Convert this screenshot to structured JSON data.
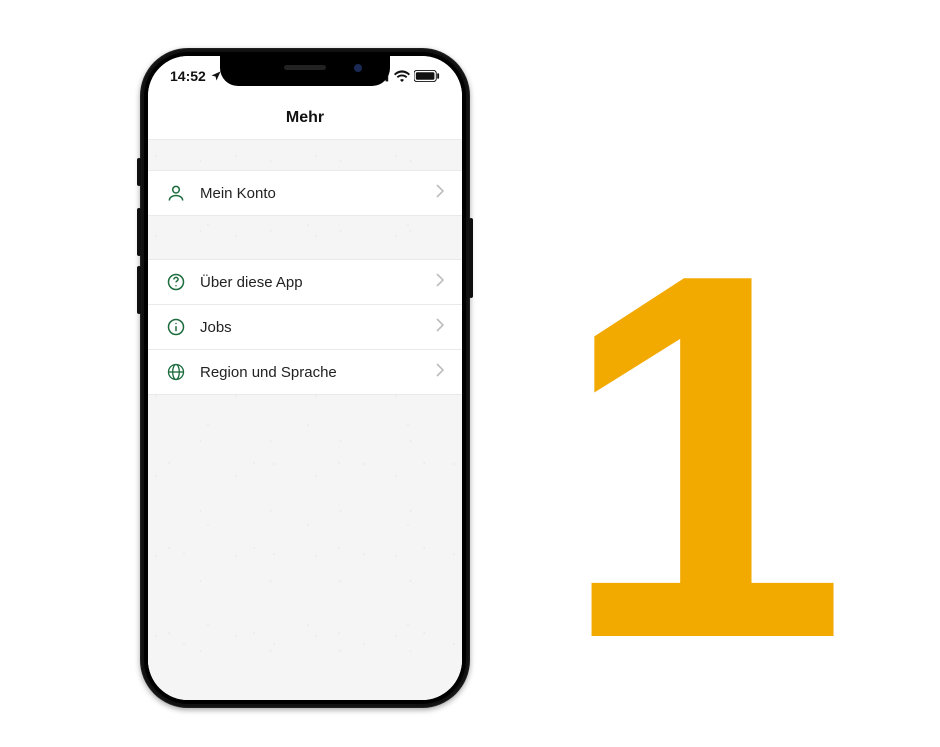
{
  "status": {
    "time": "14:52"
  },
  "header": {
    "title": "Mehr"
  },
  "menu": {
    "account": {
      "label": "Mein Konto"
    },
    "about": {
      "label": "Über diese App"
    },
    "jobs": {
      "label": "Jobs"
    },
    "region": {
      "label": "Region und Sprache"
    }
  },
  "bignum": "1"
}
